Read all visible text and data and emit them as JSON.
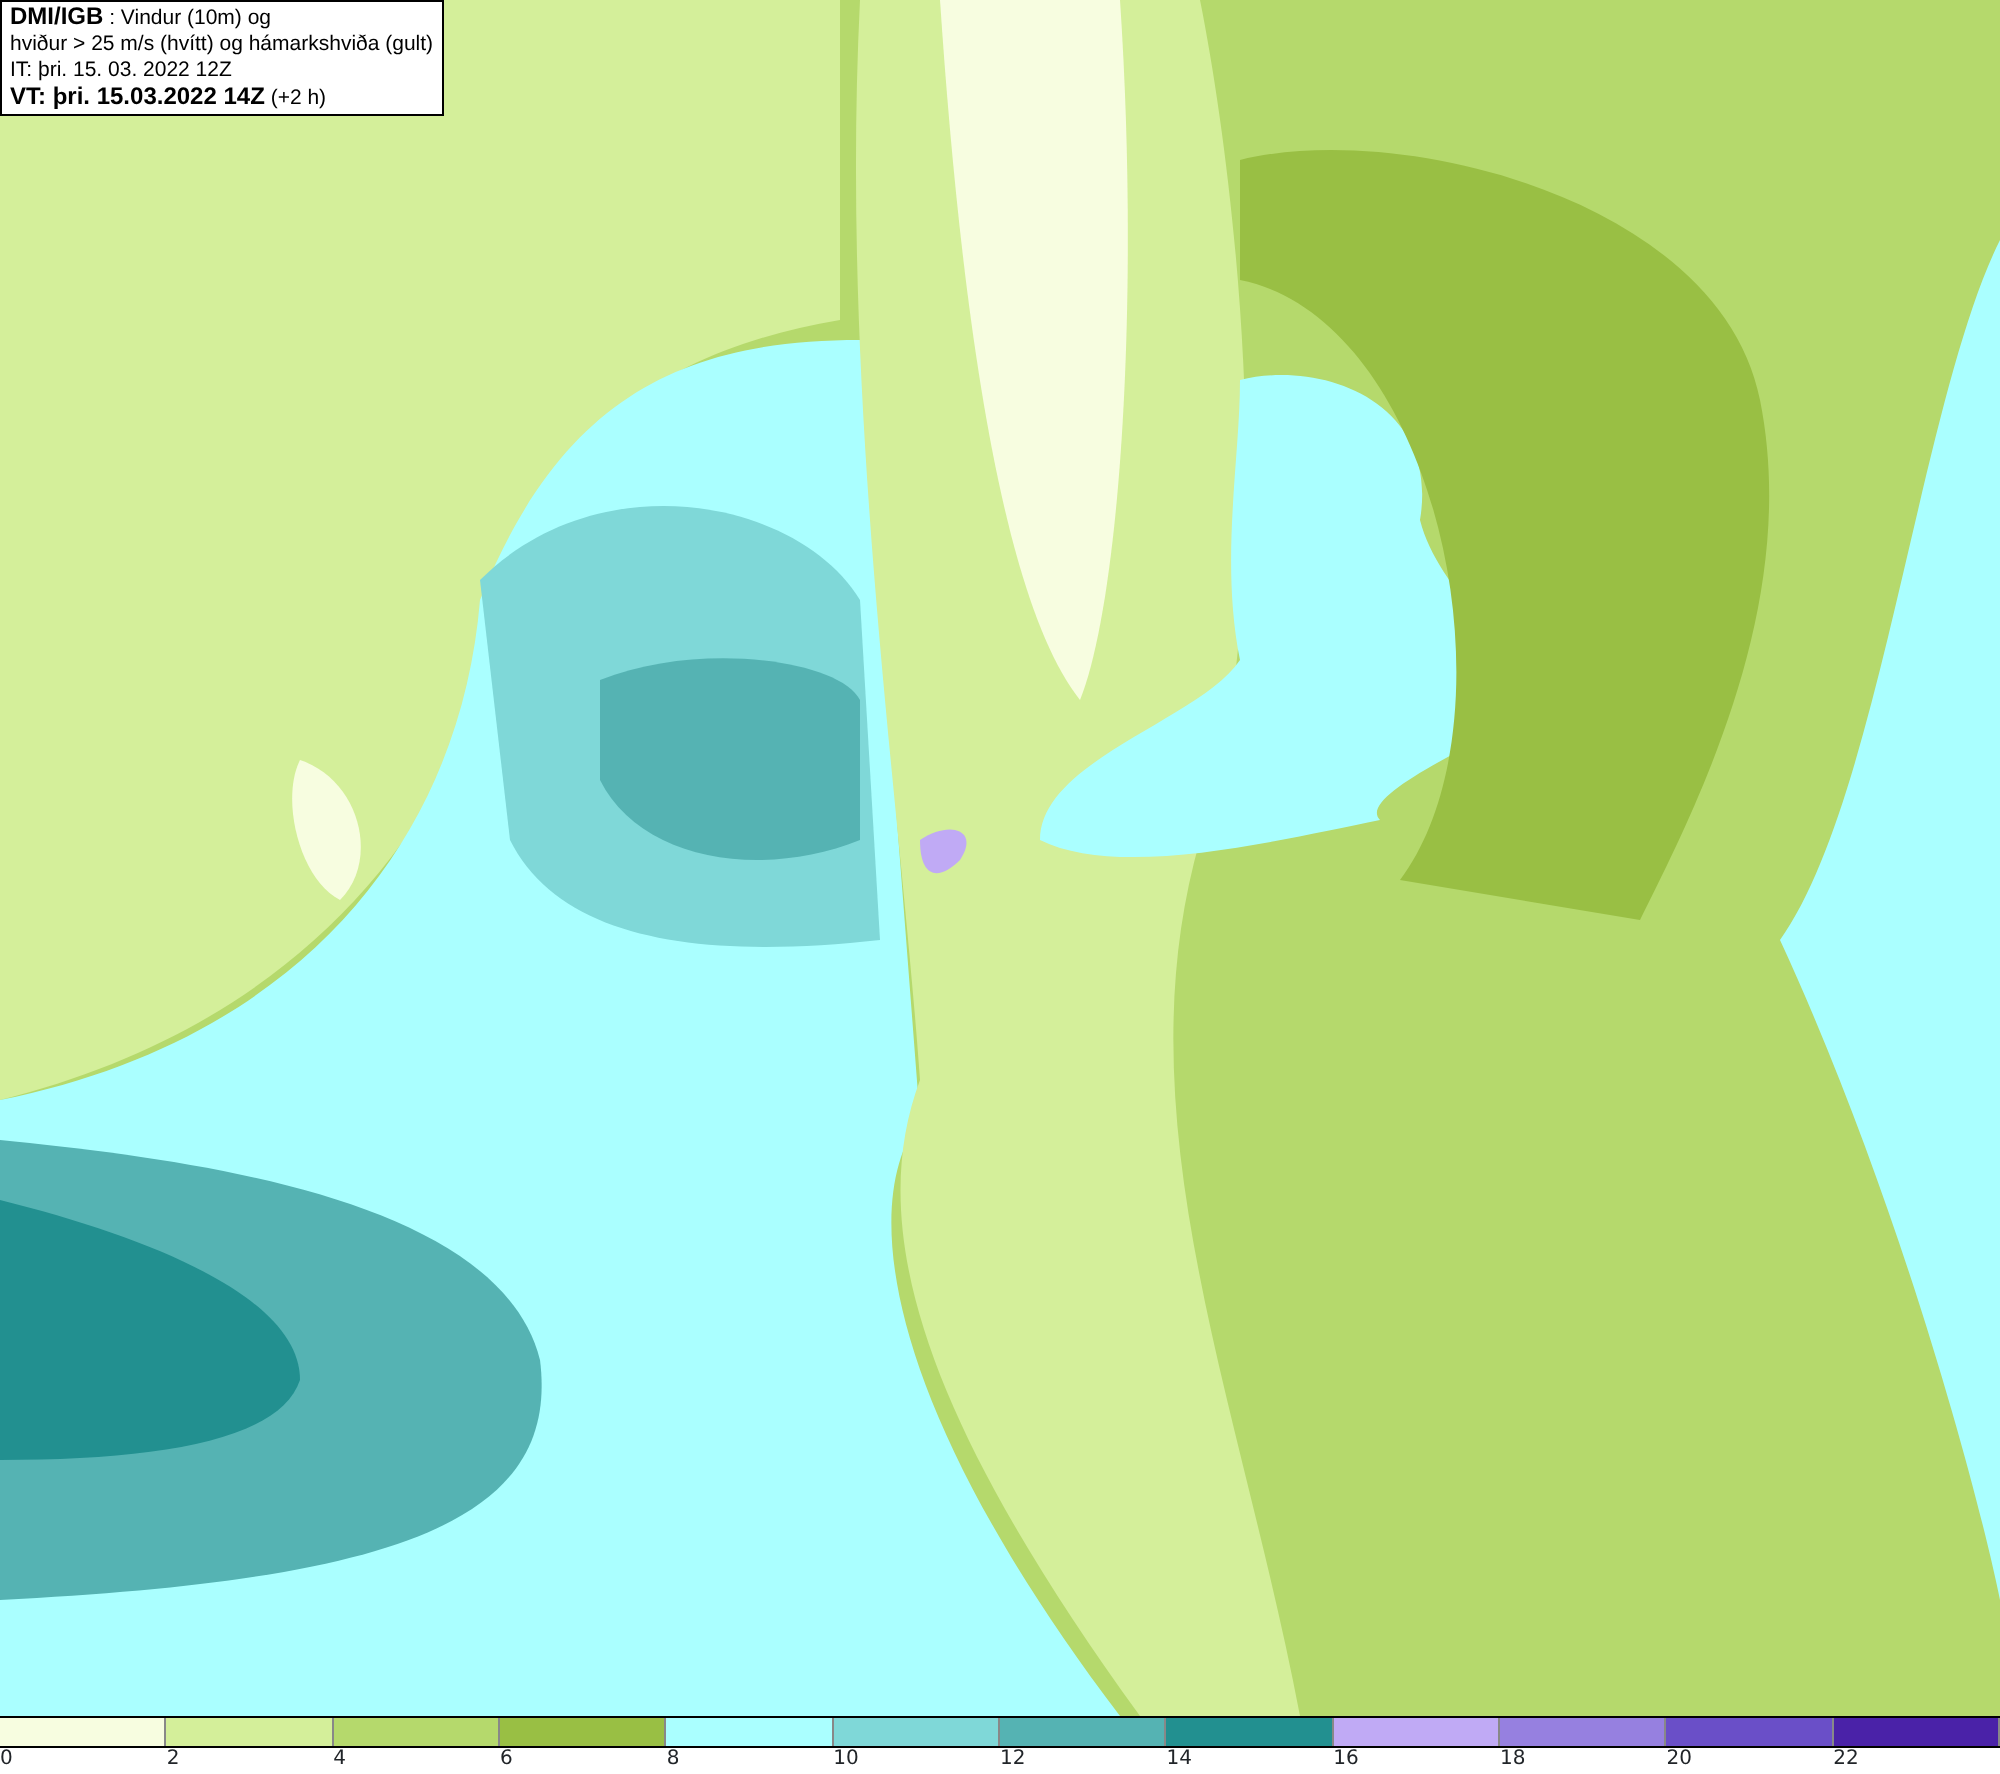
{
  "title_box": {
    "lines": [
      "**DMI/IGB** : Vindur (10m) og",
      "hviður > 25 m/s (hvítt) og hámarkshviða (gult)",
      "IT: þri. 15. 03. 2022 12Z",
      "**VT: þri. 15.03.2022 14Z** (+2 h)"
    ]
  },
  "legend": [
    {
      "color": "#f7fde0",
      "label": "0"
    },
    {
      "color": "#d4ef9a",
      "label": "2"
    },
    {
      "color": "#b5d96c",
      "label": "4"
    },
    {
      "color": "#99bf44",
      "label": "6"
    },
    {
      "color": "#aaffff",
      "label": "8"
    },
    {
      "color": "#7fd8d8",
      "label": "10"
    },
    {
      "color": "#55b3b3",
      "label": "12"
    },
    {
      "color": "#229090",
      "label": "14"
    },
    {
      "color": "#c0aaf5",
      "label": "16"
    },
    {
      "color": "#9680e0",
      "label": "18"
    },
    {
      "color": "#6a4fc8",
      "label": "20"
    },
    {
      "color": "#4a22a8",
      "label": "22"
    }
  ]
}
